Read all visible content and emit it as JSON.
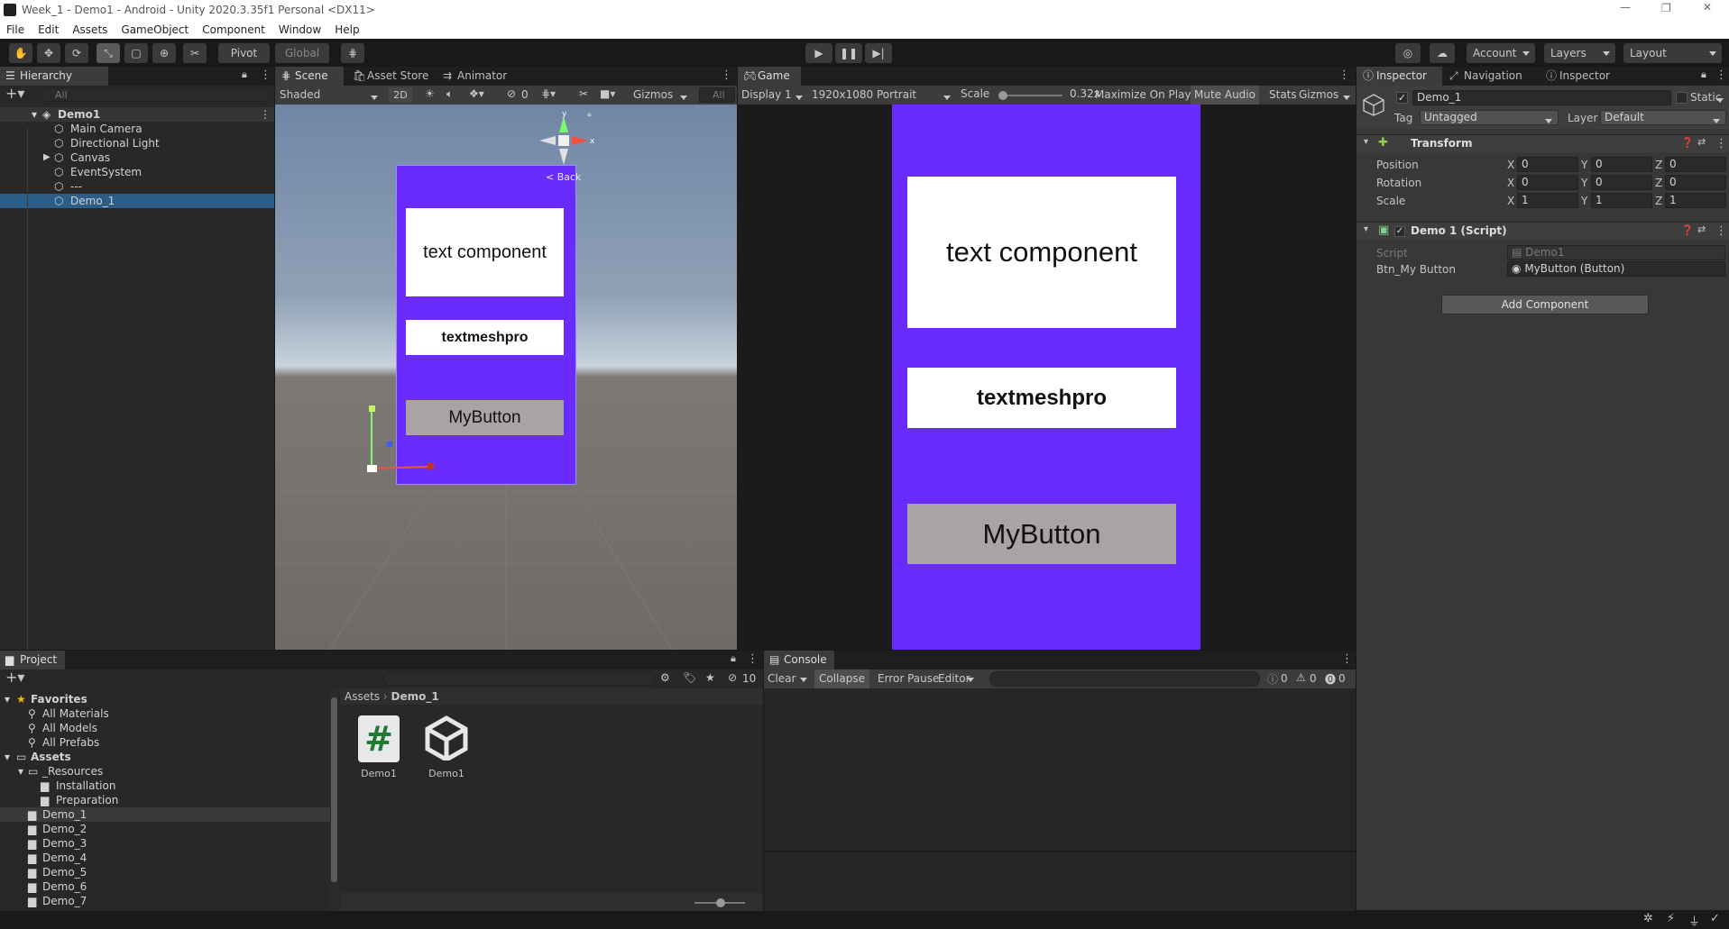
{
  "window": {
    "title": "Week_1 - Demo1 - Android - Unity 2020.3.35f1 Personal <DX11>"
  },
  "menu": [
    "File",
    "Edit",
    "Assets",
    "GameObject",
    "Component",
    "Window",
    "Help"
  ],
  "toolbar": {
    "pivot": "Pivot",
    "global": "Global",
    "account": "Account",
    "layers": "Layers",
    "layout": "Layout"
  },
  "hierarchy": {
    "tab": "Hierarchy",
    "search_placeholder": "All",
    "scene": "Demo1",
    "items": [
      {
        "label": "Main Camera",
        "selected": false,
        "expandable": false
      },
      {
        "label": "Directional Light",
        "selected": false,
        "expandable": false
      },
      {
        "label": "Canvas",
        "selected": false,
        "expandable": true
      },
      {
        "label": "EventSystem",
        "selected": false,
        "expandable": false
      },
      {
        "label": "---",
        "selected": false,
        "expandable": false
      },
      {
        "label": "Demo_1",
        "selected": true,
        "expandable": false
      }
    ]
  },
  "scene": {
    "tabs": [
      "Scene",
      "Asset Store",
      "Animator"
    ],
    "shading": "Shaded",
    "mode2d": "2D",
    "hidden_count": "0",
    "gizmos": "Gizmos",
    "search_placeholder": "All",
    "back_label": "Back",
    "text_component": "text component",
    "textmeshpro": "textmeshpro",
    "button_label": "MyButton"
  },
  "game": {
    "tab": "Game",
    "display": "Display 1",
    "resolution": "1920x1080 Portrait",
    "scale_label": "Scale",
    "scale_value": "0.32x",
    "maximize": "Maximize On Play",
    "mute": "Mute Audio",
    "stats": "Stats",
    "gizmos": "Gizmos",
    "text_component": "text component",
    "textmeshpro": "textmeshpro",
    "button_label": "MyButton"
  },
  "inspector": {
    "tabs": [
      "Inspector",
      "Navigation",
      "Inspector"
    ],
    "object_name": "Demo_1",
    "static_label": "Static",
    "tag_label": "Tag",
    "tag_value": "Untagged",
    "layer_label": "Layer",
    "layer_value": "Default",
    "transform": {
      "title": "Transform",
      "rows": [
        {
          "label": "Position",
          "x": "0",
          "y": "0",
          "z": "0"
        },
        {
          "label": "Rotation",
          "x": "0",
          "y": "0",
          "z": "0"
        },
        {
          "label": "Scale",
          "x": "1",
          "y": "1",
          "z": "1"
        }
      ]
    },
    "script_component": {
      "title": "Demo 1 (Script)",
      "script_label": "Script",
      "script_value": "Demo1",
      "field_label": "Btn_My Button",
      "field_value": "MyButton (Button)"
    },
    "add_component": "Add Component"
  },
  "project": {
    "tab": "Project",
    "favorites_label": "Favorites",
    "favorites": [
      "All Materials",
      "All Models",
      "All Prefabs"
    ],
    "assets_label": "Assets",
    "resources": "_Resources",
    "resources_children": [
      "Installation",
      "Preparation"
    ],
    "folders": [
      {
        "label": "Demo_1",
        "selected": true
      },
      {
        "label": "Demo_2",
        "selected": false
      },
      {
        "label": "Demo_3",
        "selected": false
      },
      {
        "label": "Demo_4",
        "selected": false
      },
      {
        "label": "Demo_5",
        "selected": false
      },
      {
        "label": "Demo_6",
        "selected": false
      },
      {
        "label": "Demo_7",
        "selected": false
      }
    ],
    "breadcrumb": [
      "Assets",
      "Demo_1"
    ],
    "hidden_count": "10",
    "files": [
      {
        "label": "Demo1",
        "icon": "csharp-script-icon"
      },
      {
        "label": "Demo1",
        "icon": "unity-scene-icon"
      }
    ]
  },
  "console": {
    "tab": "Console",
    "clear": "Clear",
    "collapse": "Collapse",
    "error_pause": "Error Pause",
    "editor": "Editor",
    "info_count": "0",
    "warn_count": "0",
    "error_count": "0"
  },
  "colors": {
    "canvas_purple": "#6a2bff",
    "selection": "#2c5d87",
    "panel": "#282828"
  }
}
